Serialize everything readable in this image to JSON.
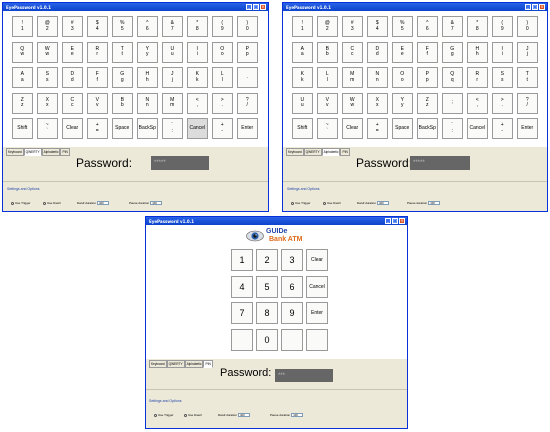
{
  "window_title": "EyePassword v1.0.1",
  "row1": [
    [
      "!",
      "1"
    ],
    [
      "@",
      "2"
    ],
    [
      "#",
      "3"
    ],
    [
      "$",
      "4"
    ],
    [
      "%",
      "5"
    ],
    [
      "^",
      "6"
    ],
    [
      "&",
      "7"
    ],
    [
      "*",
      "8"
    ],
    [
      "(",
      "9"
    ],
    [
      ")",
      "0"
    ]
  ],
  "left_kb": {
    "row2": [
      [
        "Q",
        "w"
      ],
      [
        "W",
        "w"
      ],
      [
        "E",
        "e"
      ],
      [
        "R",
        "r"
      ],
      [
        "T",
        "t"
      ],
      [
        "Y",
        "y"
      ],
      [
        "U",
        "u"
      ],
      [
        "I",
        "i"
      ],
      [
        "O",
        "o"
      ],
      [
        "P",
        "p"
      ]
    ],
    "row3": [
      [
        "A",
        "a"
      ],
      [
        "S",
        "s"
      ],
      [
        "D",
        "d"
      ],
      [
        "F",
        "f"
      ],
      [
        "G",
        "g"
      ],
      [
        "H",
        "h"
      ],
      [
        "J",
        "j"
      ],
      [
        "K",
        "k"
      ],
      [
        "L",
        "l"
      ],
      [
        "",
        "."
      ]
    ],
    "row4": [
      [
        "Z",
        "z"
      ],
      [
        "X",
        "x"
      ],
      [
        "C",
        "c"
      ],
      [
        "V",
        "v"
      ],
      [
        "B",
        "b"
      ],
      [
        "N",
        "n"
      ],
      [
        "M",
        "m"
      ],
      [
        "<",
        ","
      ],
      [
        ">",
        "."
      ],
      [
        "?",
        "/"
      ]
    ],
    "row5": [
      "Shift",
      "~\n`",
      "Clear",
      "+\n=",
      "Space",
      "BackSp",
      "¨\n:",
      "Cancel",
      "+\n-",
      "Enter"
    ]
  },
  "right_kb": {
    "row2": [
      [
        "A",
        "a"
      ],
      [
        "B",
        "b"
      ],
      [
        "C",
        "c"
      ],
      [
        "D",
        "d"
      ],
      [
        "E",
        "e"
      ],
      [
        "F",
        "f"
      ],
      [
        "G",
        "g"
      ],
      [
        "H",
        "h"
      ],
      [
        "I",
        "i"
      ],
      [
        "J",
        "j"
      ]
    ],
    "row3": [
      [
        "K",
        "k"
      ],
      [
        "L",
        "l"
      ],
      [
        "M",
        "m"
      ],
      [
        "N",
        "n"
      ],
      [
        "O",
        "o"
      ],
      [
        "P",
        "p"
      ],
      [
        "Q",
        "q"
      ],
      [
        "R",
        "r"
      ],
      [
        "S",
        "s"
      ],
      [
        "T",
        "t"
      ]
    ],
    "row4": [
      [
        "U",
        "u"
      ],
      [
        "V",
        "v"
      ],
      [
        "W",
        "w"
      ],
      [
        "X",
        "x"
      ],
      [
        "Y",
        "y"
      ],
      [
        "Z",
        "z"
      ],
      [
        "",
        ";"
      ],
      [
        "<",
        ","
      ],
      [
        ">",
        "."
      ],
      [
        "?",
        "/"
      ]
    ],
    "row5": [
      "Shift",
      "~\n`",
      "Clear",
      "+\n=",
      "Space",
      "BackSp",
      "¨\n:",
      "Cancel",
      "+\n-",
      "Enter"
    ]
  },
  "tabs": [
    "Keyboard",
    "QWERTY",
    "Alphabetic",
    "PIN"
  ],
  "password_label": "Password:",
  "password_masked_kb": "*****",
  "password_masked_atm": "***",
  "settings_title": "Settings and Options",
  "opt_trigger": "Use Trigger",
  "opt_dwell": "Use Dwell",
  "dwell_label": "Dwell duration",
  "dwell_value": "400",
  "pause_label": "Pause duration",
  "pause_value": "100",
  "logo_line1": "GUIDe",
  "logo_line2": "Bank ATM",
  "atm_keys": [
    "1",
    "2",
    "3",
    "Clear",
    "4",
    "5",
    "6",
    "Cancel",
    "7",
    "8",
    "9",
    "Enter",
    "",
    "0",
    "",
    ""
  ],
  "colors": {
    "titlebar": "#0b43cb",
    "panel": "#ece9d8",
    "pw_box": "#666666",
    "logo_blue": "#2244aa",
    "logo_orange": "#e06a1a"
  }
}
